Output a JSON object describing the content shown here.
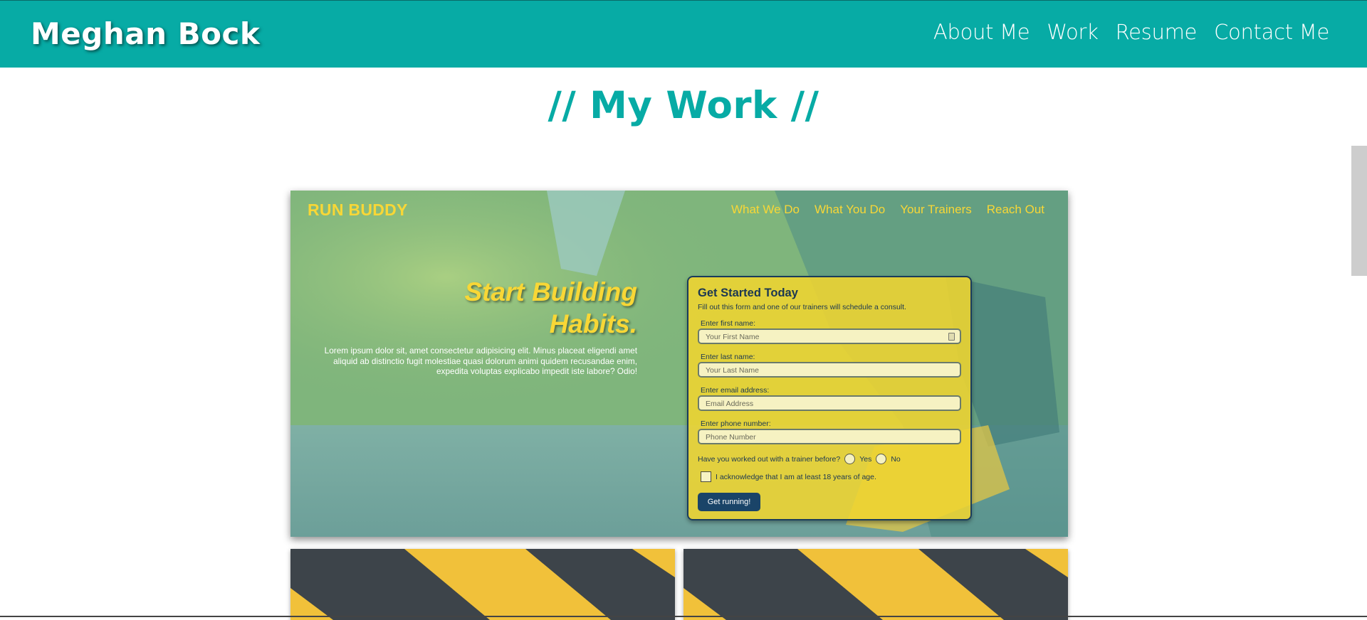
{
  "header": {
    "brand": "Meghan Bock",
    "nav": [
      "About Me",
      "Work",
      "Resume",
      "Contact Me"
    ]
  },
  "section": {
    "title": "// My Work //"
  },
  "featured": {
    "logo": "RUN BUDDY",
    "nav": [
      "What We Do",
      "What You Do",
      "Your Trainers",
      "Reach Out"
    ],
    "hero_title": "Start Building Habits.",
    "hero_text": "Lorem ipsum dolor sit, amet consectetur adipisicing elit. Minus placeat eligendi amet aliquid ab distinctio fugit molestiae quasi dolorum animi quidem recusandae enim, expedita voluptas explicabo impedit iste labore? Odio!",
    "form": {
      "title": "Get Started Today",
      "subtitle": "Fill out this form and one of our trainers will schedule a consult.",
      "fields": [
        {
          "label": "Enter first name:",
          "placeholder": "Your First Name"
        },
        {
          "label": "Enter last name:",
          "placeholder": "Your Last Name"
        },
        {
          "label": "Enter email address:",
          "placeholder": "Email Address"
        },
        {
          "label": "Enter phone number:",
          "placeholder": "Phone Number"
        }
      ],
      "question": "Have you worked out with a trainer before?",
      "option_yes": "Yes",
      "option_no": "No",
      "acknowledge": "I acknowledge that I am at least 18 years of age.",
      "submit": "Get running!"
    }
  },
  "colors": {
    "header_bg": "#07aba5",
    "accent": "#07aba5",
    "runbuddy_yellow": "#f8d736",
    "runbuddy_navy": "#1a4468"
  }
}
